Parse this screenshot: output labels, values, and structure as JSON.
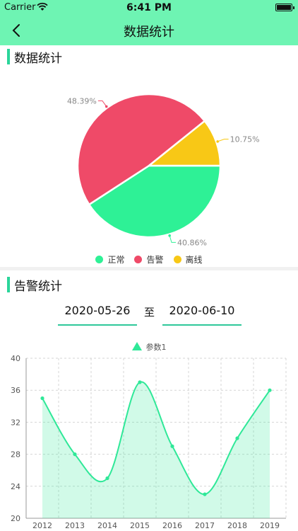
{
  "status": {
    "carrier": "Carrier",
    "time": "6:41 PM"
  },
  "nav": {
    "title": "数据统计"
  },
  "sections": {
    "data_stats": "数据统计",
    "alarm_stats": "告警统计"
  },
  "pie": {
    "legend": [
      {
        "name": "正常",
        "color": "#2ef196"
      },
      {
        "name": "告警",
        "color": "#ef4a68"
      },
      {
        "name": "离线",
        "color": "#f8c816"
      }
    ]
  },
  "date_range": {
    "start": "2020-05-26",
    "separator": "至",
    "end": "2020-06-10"
  },
  "chart_data": [
    {
      "type": "pie",
      "labels": [
        "正常",
        "告警",
        "离线"
      ],
      "values": [
        40.86,
        48.39,
        10.75
      ],
      "value_labels": [
        "40.86%",
        "48.39%",
        "10.75%"
      ],
      "colors": [
        "#2ef196",
        "#ef4a68",
        "#f8c816"
      ],
      "legend": "bottom"
    },
    {
      "type": "area",
      "x": [
        "2012",
        "2013",
        "2014",
        "2015",
        "2016",
        "2017",
        "2018",
        "2019"
      ],
      "series": [
        {
          "name": "参数1",
          "values": [
            35,
            28,
            25,
            37,
            29,
            23,
            30,
            36
          ]
        }
      ],
      "ylim": [
        20,
        40
      ],
      "yticks": [
        "20",
        "24",
        "28",
        "32",
        "36",
        "40"
      ],
      "grid": true,
      "legend": "top-center",
      "color": "#2fe898"
    }
  ]
}
